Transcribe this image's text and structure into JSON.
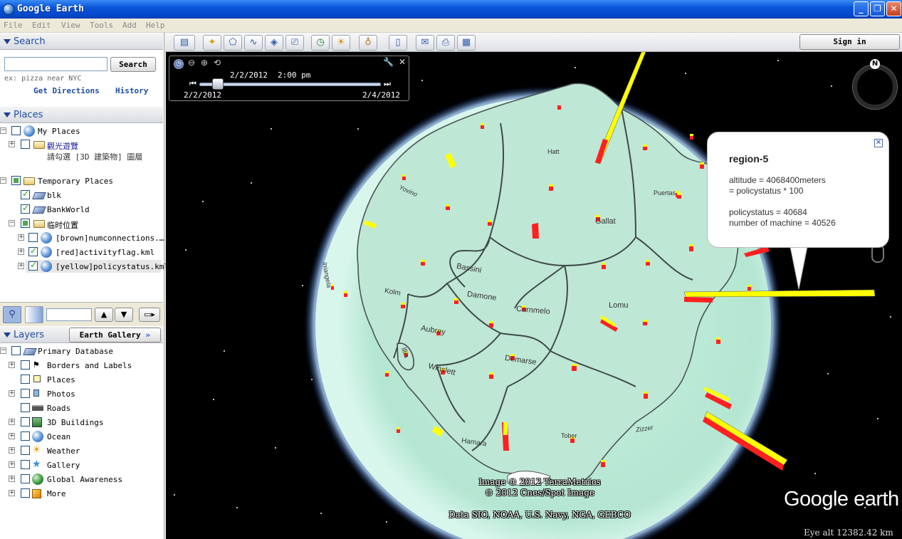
{
  "window": {
    "title": "Google Earth",
    "controls": {
      "minimize": "_",
      "maximize": "❐",
      "close": "✕"
    }
  },
  "menu": [
    "File",
    "Edit",
    "View",
    "Tools",
    "Add",
    "Help"
  ],
  "search": {
    "header": "Search",
    "input_value": "",
    "button": "Search",
    "hint": "ex: pizza near NYC",
    "get_directions": "Get Directions",
    "history": "History"
  },
  "places": {
    "header": "Places",
    "items": [
      {
        "label": "My Places"
      },
      {
        "label": "觀光遊覽"
      },
      {
        "label": "請勾選 [3D 建築物] 圖層"
      },
      {
        "label": "Temporary Places"
      },
      {
        "label": "blk"
      },
      {
        "label": "BankWorld"
      },
      {
        "label": "临时位置"
      },
      {
        "label": "[brown]numconnections.…"
      },
      {
        "label": "[red]activityflag.kml"
      },
      {
        "label": "[yellow]policystatus.kml"
      }
    ]
  },
  "places_toolbar": {
    "input_value": ""
  },
  "layers": {
    "header": "Layers",
    "earth_gallery": "Earth Gallery",
    "earth_gallery_arrow": "»",
    "items": [
      {
        "label": "Primary Database"
      },
      {
        "label": "Borders and Labels"
      },
      {
        "label": "Places"
      },
      {
        "label": "Photos"
      },
      {
        "label": "Roads"
      },
      {
        "label": "3D Buildings"
      },
      {
        "label": "Ocean"
      },
      {
        "label": "Weather"
      },
      {
        "label": "Gallery"
      },
      {
        "label": "Global Awareness"
      },
      {
        "label": "More"
      }
    ]
  },
  "toolbar": {
    "sign_in": "Sign in"
  },
  "time_slider": {
    "current_date": "2/2/2012",
    "current_time": "2:00 pm",
    "start": "2/2/2012",
    "end": "2/4/2012",
    "position": 0.07
  },
  "map": {
    "regions": [
      "Hatt",
      "Yovino",
      "Puertas",
      "Gallat",
      "Bassini",
      "Damone",
      "Kolm",
      "Carnmelo",
      "Lomu",
      "Aubrey",
      "Illia",
      "Winslett",
      "Demarse",
      "Tober",
      "Zizzer",
      "Hamara",
      "Iniangela"
    ],
    "copyright_1": "Image © 2012 TerraMetrics",
    "copyright_2": "© 2012 Cnes/Spot Image",
    "data_credit": "Data SIO, NOAA, U.S. Navy, NGA, GEBCO",
    "logo": "Google earth",
    "eye_alt": "Eye alt 12382.42 km",
    "compass_n": "N"
  },
  "balloon": {
    "title": "region-5",
    "line1": "altitude = 4068400meters",
    "line2": "= policystatus * 100",
    "line3": "policystatus = 40684",
    "line4": "number of machine = 40526"
  },
  "colors": {
    "sea": "#c8ede0",
    "land_border": "#3f4a4a",
    "bar_yellow": "#ffff00",
    "bar_red": "#ff2020",
    "panel_header_text": "#1d4ea0"
  }
}
